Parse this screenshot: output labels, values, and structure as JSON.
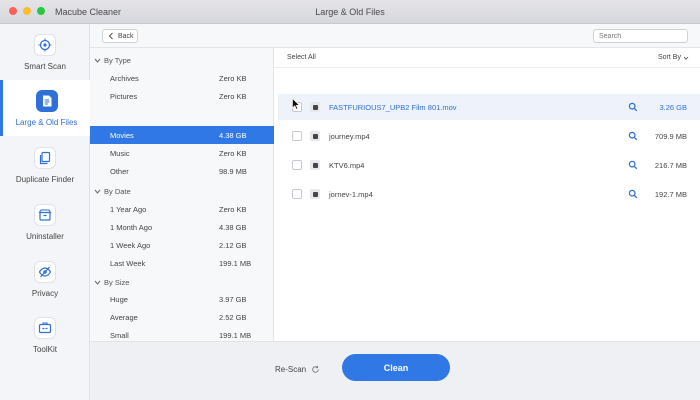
{
  "window": {
    "app_name": "Macube Cleaner",
    "title": "Large & Old Files"
  },
  "sidebar": {
    "items": [
      {
        "label": "Smart Scan",
        "icon": "target-icon"
      },
      {
        "label": "Large & Old Files",
        "icon": "document-icon",
        "active": true
      },
      {
        "label": "Duplicate Finder",
        "icon": "copy-icon"
      },
      {
        "label": "Uninstaller",
        "icon": "box-icon"
      },
      {
        "label": "Privacy",
        "icon": "eye-slash-icon"
      },
      {
        "label": "ToolKit",
        "icon": "toolkit-icon"
      }
    ]
  },
  "toolbar": {
    "back_label": "Back",
    "search_placeholder": "Search"
  },
  "categories": {
    "by_type": {
      "label": "By Type",
      "items": [
        {
          "name": "Archives",
          "size": "Zero KB"
        },
        {
          "name": "Pictures",
          "size": "Zero KB"
        },
        {
          "name": "Movies",
          "size": "4.38 GB",
          "selected": true
        },
        {
          "name": "Music",
          "size": "Zero KB"
        },
        {
          "name": "Other",
          "size": "98.9 MB"
        }
      ]
    },
    "by_date": {
      "label": "By Date",
      "items": [
        {
          "name": "1 Year Ago",
          "size": "Zero KB"
        },
        {
          "name": "1 Month Ago",
          "size": "4.38 GB"
        },
        {
          "name": "1 Week Ago",
          "size": "2.12 GB"
        },
        {
          "name": "Last Week",
          "size": "199.1 MB"
        }
      ]
    },
    "by_size": {
      "label": "By Size",
      "items": [
        {
          "name": "Huge",
          "size": "3.97 GB"
        },
        {
          "name": "Average",
          "size": "2.52 GB"
        },
        {
          "name": "Small",
          "size": "199.1 MB"
        }
      ]
    }
  },
  "files": {
    "select_all_label": "Select All",
    "sort_label": "Sort By",
    "rows": [
      {
        "name": "FASTFURIOUS7_UPB2 Film 801.mov",
        "size": "3.26 GB",
        "highlighted": true
      },
      {
        "name": "journey.mp4",
        "size": "709.9 MB"
      },
      {
        "name": "KTV6.mp4",
        "size": "216.7 MB"
      },
      {
        "name": "jornev-1.mp4",
        "size": "192.7 MB"
      }
    ]
  },
  "bottom": {
    "rescan_label": "Re-Scan",
    "clean_label": "Clean"
  },
  "colors": {
    "accent": "#3178e7",
    "accent_text": "#2f6fd8"
  }
}
